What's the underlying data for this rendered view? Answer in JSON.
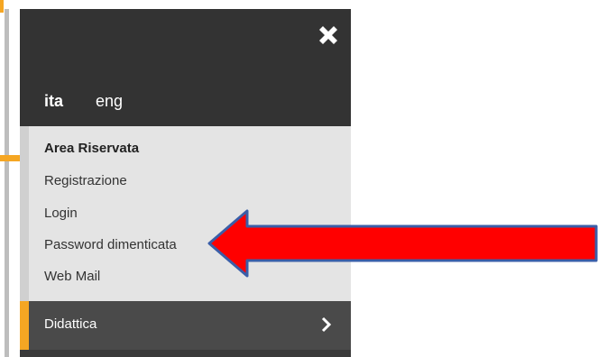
{
  "language": {
    "current": "ita",
    "alternate": "eng"
  },
  "menu": {
    "heading": "Area Riservata",
    "items": [
      {
        "label": "Registrazione"
      },
      {
        "label": "Login"
      },
      {
        "label": "Password dimenticata"
      },
      {
        "label": "Web Mail"
      }
    ]
  },
  "footer": {
    "label": "Didattica"
  },
  "colors": {
    "accent": "#f5a623",
    "header_bg": "#333333",
    "menu_bg": "#e4e4e4",
    "arrow_fill": "#ff0000",
    "arrow_stroke": "#3a5ea8"
  },
  "icons": {
    "close": "close-icon",
    "chevron": "chevron-right-icon"
  }
}
